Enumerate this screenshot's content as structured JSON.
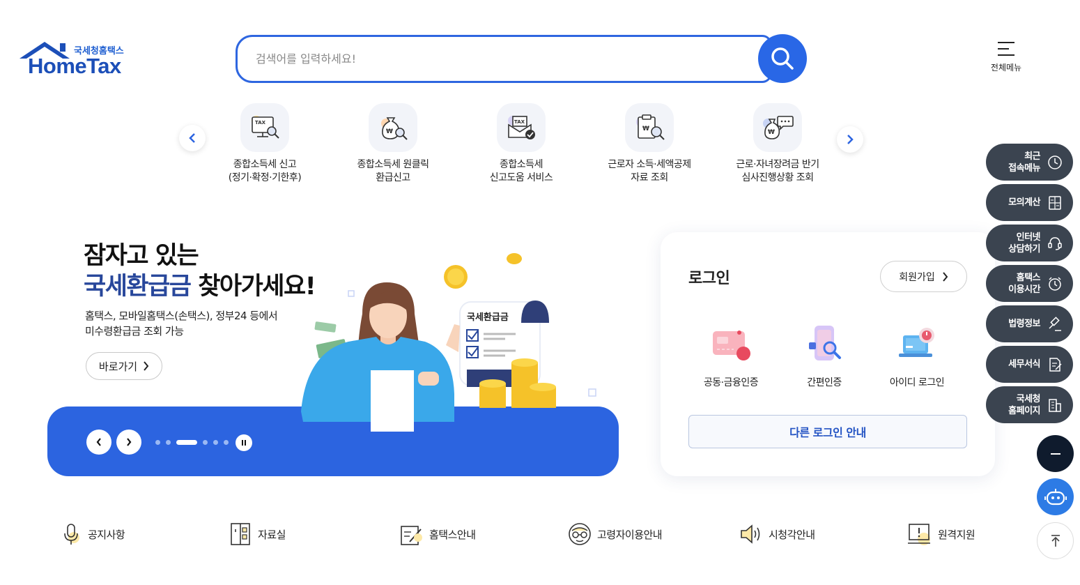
{
  "header": {
    "logo_sub": "국세청홈택스",
    "logo_main": "HomeTax",
    "search_placeholder": "검색어를 입력하세요!",
    "search_value": "",
    "all_menu_label": "전체메뉴"
  },
  "quick_services": [
    {
      "line1": "종합소득세 신고",
      "line2": "(정기·확정·기한후)",
      "icon": "tax-monitor-icon"
    },
    {
      "line1": "종합소득세 원클릭",
      "line2": "환급신고",
      "icon": "money-bag-search-icon"
    },
    {
      "line1": "종합소득세",
      "line2": "신고도움 서비스",
      "icon": "tax-envelope-check-icon"
    },
    {
      "line1": "근로자 소득·세액공제",
      "line2": "자료 조회",
      "icon": "clipboard-search-icon"
    },
    {
      "line1": "근로·자녀장려금 반기",
      "line2": "심사진행상황 조회",
      "icon": "money-bag-chat-icon"
    }
  ],
  "banner": {
    "line1": "잠자고 있는",
    "line2_highlight": "국세환급금",
    "line2_rest": " 찾아가세요!",
    "desc1": "홈택스, 모바일홈택스(손택스), 정부24 등에서",
    "desc2": "미수령환급금 조회 가능",
    "go_label": "바로가기",
    "illustration_label": "국세환급금",
    "slide_count": 6,
    "active_slide": 2
  },
  "login": {
    "title": "로그인",
    "join_label": "회원가입",
    "methods": [
      {
        "label": "공동·금융인증",
        "icon": "certificate-card-icon"
      },
      {
        "label": "간편인증",
        "icon": "phone-search-icon"
      },
      {
        "label": "아이디 로그인",
        "icon": "laptop-power-icon"
      }
    ],
    "other_login_label": "다른 로그인 안내"
  },
  "side_panel": [
    {
      "label": "최근\n접속메뉴",
      "icon": "clock-icon"
    },
    {
      "label": "모의계산",
      "icon": "calculator-icon"
    },
    {
      "label": "인터넷\n상담하기",
      "icon": "chat-headset-icon"
    },
    {
      "label": "홈택스\n이용시간",
      "icon": "alarm-clock-icon"
    },
    {
      "label": "법령정보",
      "icon": "gavel-icon"
    },
    {
      "label": "세무서식",
      "icon": "document-edit-icon"
    },
    {
      "label": "국세청\n홈페이지",
      "icon": "building-icon"
    }
  ],
  "bottom_links": [
    {
      "label": "공지사항",
      "icon": "microphone-icon"
    },
    {
      "label": "자료실",
      "icon": "cabinet-icon"
    },
    {
      "label": "홈택스안내",
      "icon": "guide-edit-icon"
    },
    {
      "label": "고령자이용안내",
      "icon": "senior-glasses-icon"
    },
    {
      "label": "시청각안내",
      "icon": "speaker-icon"
    },
    {
      "label": "원격지원",
      "icon": "remote-monitor-icon"
    }
  ],
  "colors": {
    "primary": "#2c64e0",
    "navy_text": "#28479b",
    "panel_dark": "#3b4450",
    "chatbot": "#2d7be5"
  }
}
